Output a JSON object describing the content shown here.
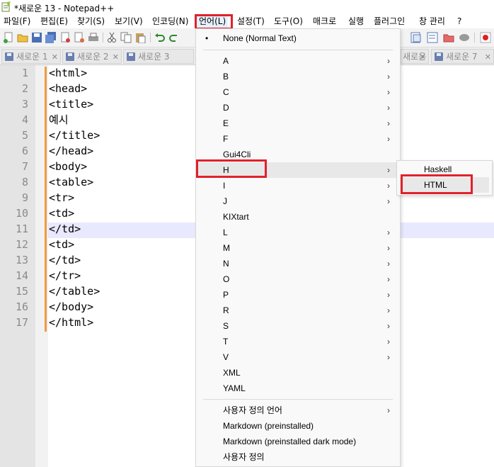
{
  "window": {
    "title": "*새로운 13 - Notepad++"
  },
  "menu_bar": [
    "파일(F)",
    "편집(E)",
    "찾기(S)",
    "보기(V)",
    "인코딩(N)",
    "언어(L)",
    "설정(T)",
    "도구(O)",
    "매크로",
    "실행",
    "플러그인",
    "창 관리",
    "?"
  ],
  "tabs": [
    {
      "label": "새로운 1"
    },
    {
      "label": "새로운 2"
    },
    {
      "label": "새로운 3"
    },
    {
      "label": "새로운 6"
    },
    {
      "label": "새로운 7"
    }
  ],
  "editor": {
    "lines": [
      "<html>",
      "<head>",
      "<title>",
      "예시",
      "</title>",
      "</head>",
      "<body>",
      "<table>",
      "<tr>",
      "<td>",
      "</td>",
      "<td>",
      "</td>",
      "</tr>",
      "</table>",
      "</body>",
      "</html>"
    ],
    "line_numbers": [
      "1",
      "2",
      "3",
      "4",
      "5",
      "6",
      "7",
      "8",
      "9",
      "10",
      "11",
      "12",
      "13",
      "14",
      "15",
      "16",
      "17"
    ],
    "current_line": 11
  },
  "language_menu": {
    "items": [
      {
        "label": "None (Normal Text)",
        "checked": true
      },
      {
        "label": "A",
        "submenu": true
      },
      {
        "label": "B",
        "submenu": true
      },
      {
        "label": "C",
        "submenu": true
      },
      {
        "label": "D",
        "submenu": true
      },
      {
        "label": "E",
        "submenu": true
      },
      {
        "label": "F",
        "submenu": true
      },
      {
        "label": "Gui4Cli"
      },
      {
        "label": "H",
        "submenu": true,
        "highlighted": true
      },
      {
        "label": "I",
        "submenu": true
      },
      {
        "label": "J",
        "submenu": true
      },
      {
        "label": "KIXtart"
      },
      {
        "label": "L",
        "submenu": true
      },
      {
        "label": "M",
        "submenu": true
      },
      {
        "label": "N",
        "submenu": true
      },
      {
        "label": "O",
        "submenu": true
      },
      {
        "label": "P",
        "submenu": true
      },
      {
        "label": "R",
        "submenu": true
      },
      {
        "label": "S",
        "submenu": true
      },
      {
        "label": "T",
        "submenu": true
      },
      {
        "label": "V",
        "submenu": true
      },
      {
        "label": "XML"
      },
      {
        "label": "YAML"
      },
      {
        "label": "사용자 정의 언어",
        "submenu": true
      },
      {
        "label": "Markdown (preinstalled)"
      },
      {
        "label": "Markdown (preinstalled dark mode)"
      },
      {
        "label": "사용자 정의"
      }
    ]
  },
  "h_submenu": {
    "items": [
      {
        "label": "Haskell"
      },
      {
        "label": "HTML",
        "highlighted": true
      }
    ]
  },
  "icons": {
    "arrow": "›",
    "bullet": "•",
    "close": "✕"
  },
  "colors": {
    "highlight_red": "#e0212b",
    "change_bar": "#f09a3b",
    "current_line": "#e8e8ff"
  }
}
